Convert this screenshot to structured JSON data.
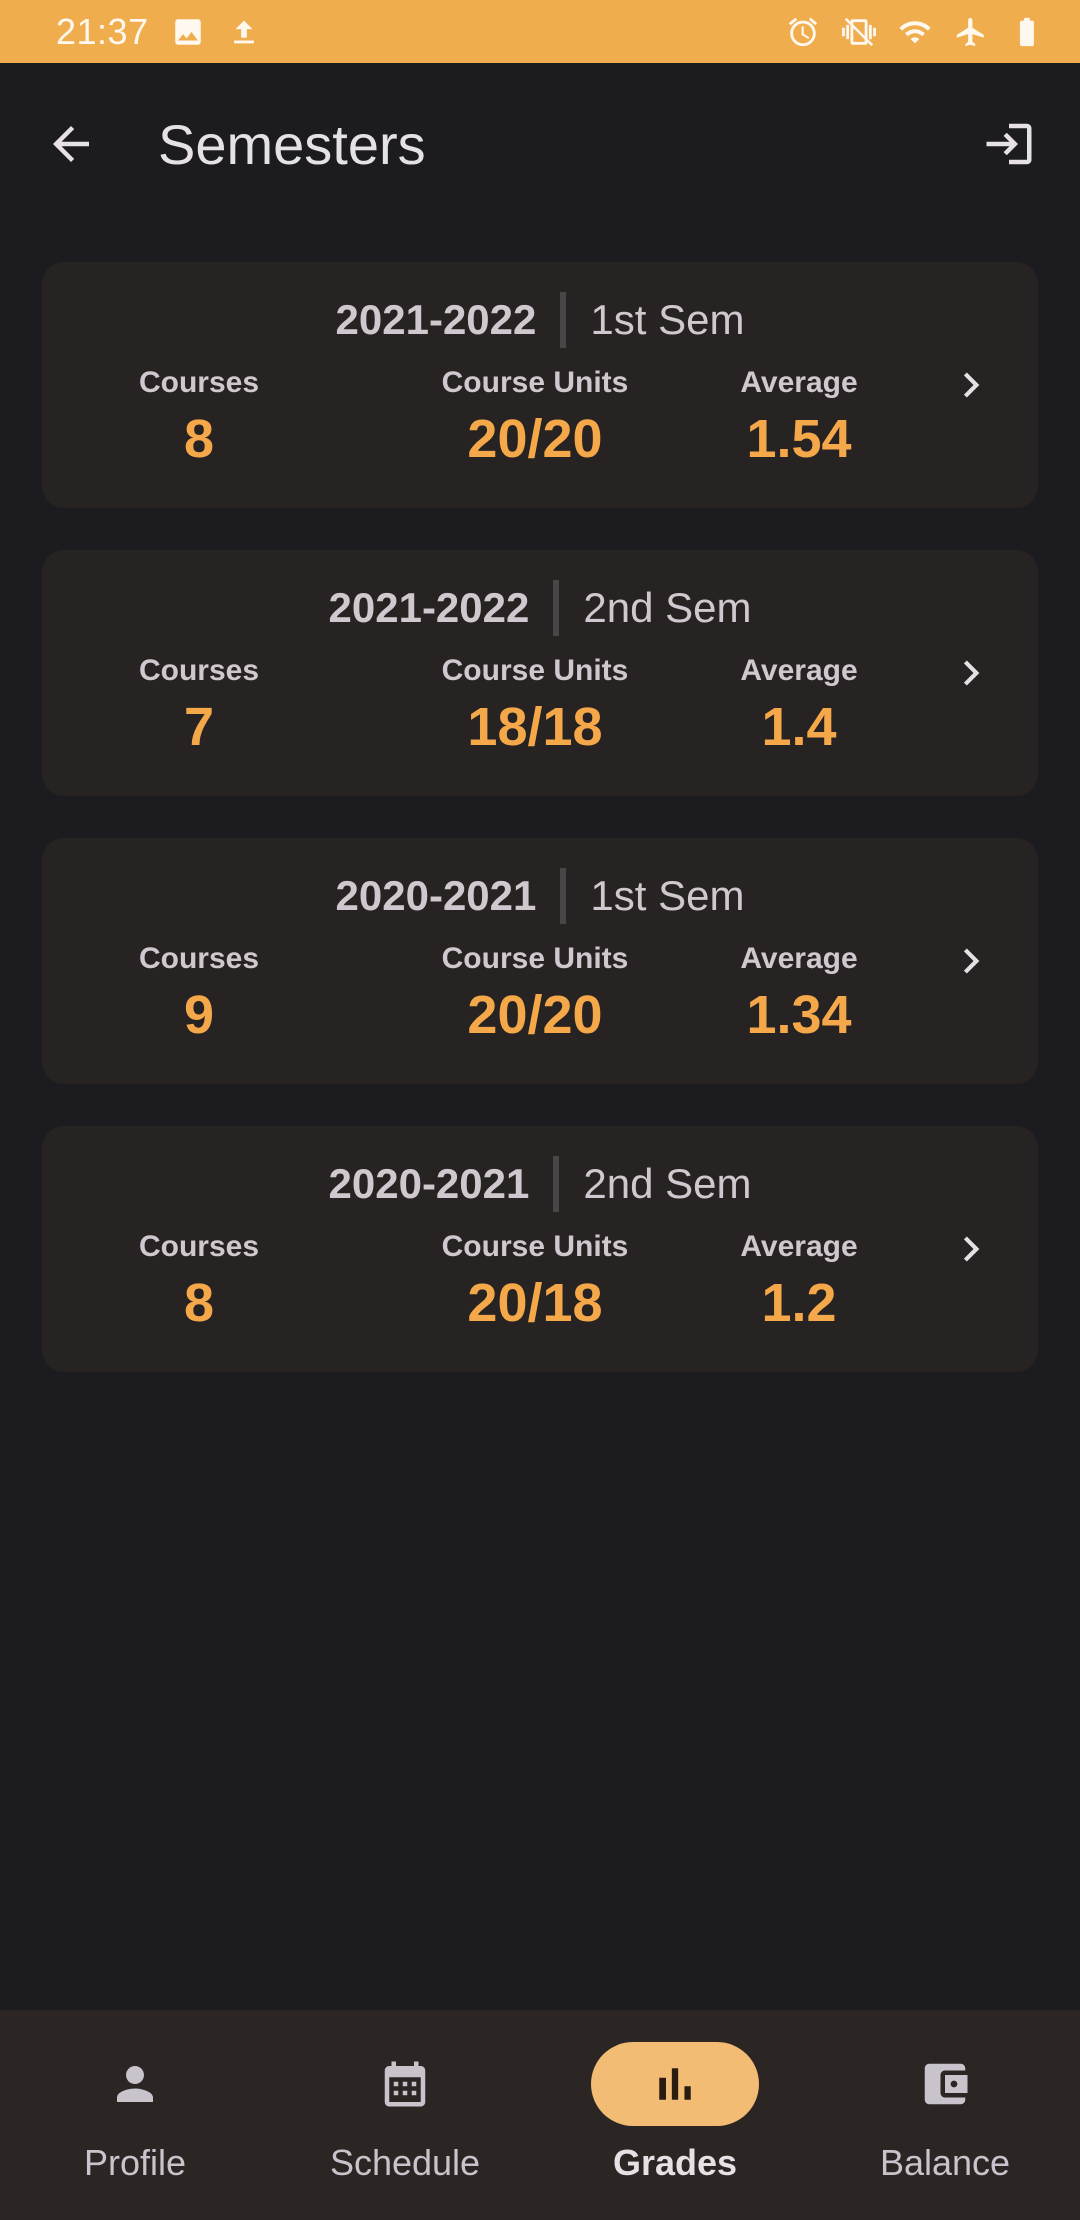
{
  "status_bar": {
    "time": "21:37",
    "left_icons": [
      "image-icon",
      "upload-icon"
    ],
    "right_icons": [
      "alarm-icon",
      "vibrate-off-icon",
      "wifi-icon",
      "airplane-icon",
      "battery-icon"
    ],
    "color": "#f0ad4e"
  },
  "header": {
    "title": "Semesters",
    "back_icon": "arrow-back-icon",
    "logout_icon": "logout-icon"
  },
  "semesters": [
    {
      "year": "2021-2022",
      "term": "1st Sem",
      "courses_label": "Courses",
      "courses": "8",
      "units_label": "Course Units",
      "units_earned": "20",
      "units_sep": "/",
      "units_total": "20",
      "average_label": "Average",
      "average": "1.54"
    },
    {
      "year": "2021-2022",
      "term": "2nd Sem",
      "courses_label": "Courses",
      "courses": "7",
      "units_label": "Course Units",
      "units_earned": "18",
      "units_sep": "/",
      "units_total": "18",
      "average_label": "Average",
      "average": "1.4"
    },
    {
      "year": "2020-2021",
      "term": "1st Sem",
      "courses_label": "Courses",
      "courses": "9",
      "units_label": "Course Units",
      "units_earned": "20",
      "units_sep": "/",
      "units_total": "20",
      "average_label": "Average",
      "average": "1.34"
    },
    {
      "year": "2020-2021",
      "term": "2nd Sem",
      "courses_label": "Courses",
      "courses": "8",
      "units_label": "Course Units",
      "units_earned": "20",
      "units_sep": "/",
      "units_total": "18",
      "average_label": "Average",
      "average": "1.2"
    }
  ],
  "bottom_nav": {
    "items": [
      {
        "label": "Profile",
        "icon": "person-icon",
        "active": false
      },
      {
        "label": "Schedule",
        "icon": "calendar-icon",
        "active": false
      },
      {
        "label": "Grades",
        "icon": "bar-chart-icon",
        "active": true
      },
      {
        "label": "Balance",
        "icon": "wallet-icon",
        "active": false
      }
    ]
  },
  "colors": {
    "accent": "#f5a84a",
    "background": "#1c1b1f",
    "card": "#262322",
    "active_pill": "#f3bc75"
  }
}
